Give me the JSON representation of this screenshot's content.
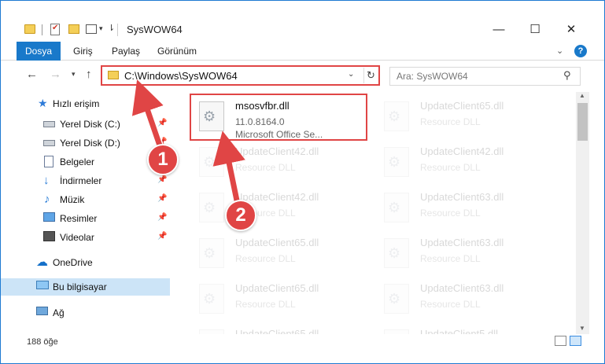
{
  "window": {
    "title": "SysWOW64",
    "minimize_icon": "minimize-icon",
    "maximize_icon": "maximize-icon",
    "close_icon": "close-icon"
  },
  "ribbon": {
    "tabs": [
      "Dosya",
      "Giriş",
      "Paylaş",
      "Görünüm"
    ]
  },
  "address": {
    "path": "C:\\Windows\\SysWOW64",
    "search_placeholder": "Ara: SysWOW64"
  },
  "sidebar": {
    "items": [
      {
        "label": "Hızlı erişim",
        "icon": "star-icon",
        "pinned": false
      },
      {
        "label": "Yerel Disk (C:)",
        "icon": "drive-icon",
        "pinned": true
      },
      {
        "label": "Yerel Disk (D:)",
        "icon": "drive-icon",
        "pinned": true
      },
      {
        "label": "Belgeler",
        "icon": "documents-icon",
        "pinned": true
      },
      {
        "label": "İndirmeler",
        "icon": "downloads-icon",
        "pinned": true
      },
      {
        "label": "Müzik",
        "icon": "music-icon",
        "pinned": true
      },
      {
        "label": "Resimler",
        "icon": "pictures-icon",
        "pinned": true
      },
      {
        "label": "Videolar",
        "icon": "videos-icon",
        "pinned": true
      },
      {
        "label": "OneDrive",
        "icon": "onedrive-icon",
        "pinned": false
      },
      {
        "label": "Bu bilgisayar",
        "icon": "this-pc-icon",
        "pinned": false,
        "selected": true
      },
      {
        "label": "Ağ",
        "icon": "network-icon",
        "pinned": false
      }
    ]
  },
  "files": {
    "highlighted": {
      "name": "msosvfbr.dll",
      "version": "11.0.8164.0",
      "description": "Microsoft Office Se..."
    },
    "faded": [
      {
        "name": "UpdateClient65.dll",
        "type": "Resource DLL"
      },
      {
        "name": "UpdateClient42.dll",
        "type": "Resource DLL"
      },
      {
        "name": "UpdateClient42.dll",
        "type": "Resource DLL"
      },
      {
        "name": "UpdateClient42.dll",
        "type": "Resource DLL"
      },
      {
        "name": "UpdateClient63.dll",
        "type": "Resource DLL"
      },
      {
        "name": "UpdateClient65.dll",
        "type": "Resource DLL"
      },
      {
        "name": "UpdateClient63.dll",
        "type": "Resource DLL"
      },
      {
        "name": "UpdateClient65.dll",
        "type": "Resource DLL"
      },
      {
        "name": "UpdateClient63.dll",
        "type": "Resource DLL"
      },
      {
        "name": "UpdateClient65.dll",
        "type": "Resource DLL"
      },
      {
        "name": "UpdateClient5.dll",
        "type": "Resource DLL"
      },
      {
        "name": "UpdateClient65.dll",
        "type": "Resource DLL"
      }
    ]
  },
  "status": {
    "item_count": "188 öğe"
  },
  "annotations": {
    "step1": "1",
    "step2": "2",
    "color": "#e04545"
  }
}
